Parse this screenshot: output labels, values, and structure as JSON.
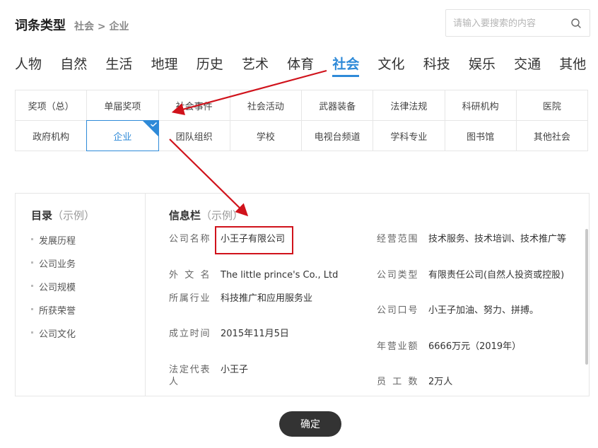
{
  "header": {
    "title": "词条类型",
    "breadcrumb": "社会 > 企业"
  },
  "search": {
    "placeholder": "请输入要搜索的内容"
  },
  "categories": [
    "人物",
    "自然",
    "生活",
    "地理",
    "历史",
    "艺术",
    "体育",
    "社会",
    "文化",
    "科技",
    "娱乐",
    "交通",
    "其他"
  ],
  "active_category": "社会",
  "subcategories": {
    "row1": [
      "奖项（总）",
      "单届奖项",
      "社会事件",
      "社会活动",
      "武器装备",
      "法律法规",
      "科研机构",
      "医院"
    ],
    "row2": [
      "政府机构",
      "企业",
      "团队组织",
      "学校",
      "电视台频道",
      "学科专业",
      "图书馆",
      "其他社会"
    ]
  },
  "selected_subcategory": "企业",
  "toc": {
    "title": "目录",
    "title_note": "（示例）",
    "items": [
      "发展历程",
      "公司业务",
      "公司规模",
      "所获荣誉",
      "公司文化"
    ]
  },
  "info": {
    "title": "信息栏",
    "title_note": "（示例）",
    "left": [
      {
        "label": "公司名称",
        "value": "小王子有限公司"
      },
      {
        "label": "外文名",
        "value": "The little prince's Co., Ltd"
      },
      {
        "label": "所属行业",
        "value": "科技推广和应用服务业"
      },
      {
        "label": "成立时间",
        "value": "2015年11月5日"
      },
      {
        "label": "法定代表人",
        "value": "小王子"
      }
    ],
    "right": [
      {
        "label": "经营范围",
        "value": "技术服务、技术培训、技术推广等"
      },
      {
        "label": "公司类型",
        "value": "有限责任公司(自然人投资或控股)"
      },
      {
        "label": "公司口号",
        "value": "小王子加油、努力、拼搏。"
      },
      {
        "label": "年营业额",
        "value": "6666万元（2019年）"
      },
      {
        "label": "员工数",
        "value": "2万人"
      }
    ]
  },
  "confirm_label": "确定",
  "colors": {
    "accent": "#2e8ad8",
    "annotation": "#d0121b",
    "button": "#333333"
  }
}
